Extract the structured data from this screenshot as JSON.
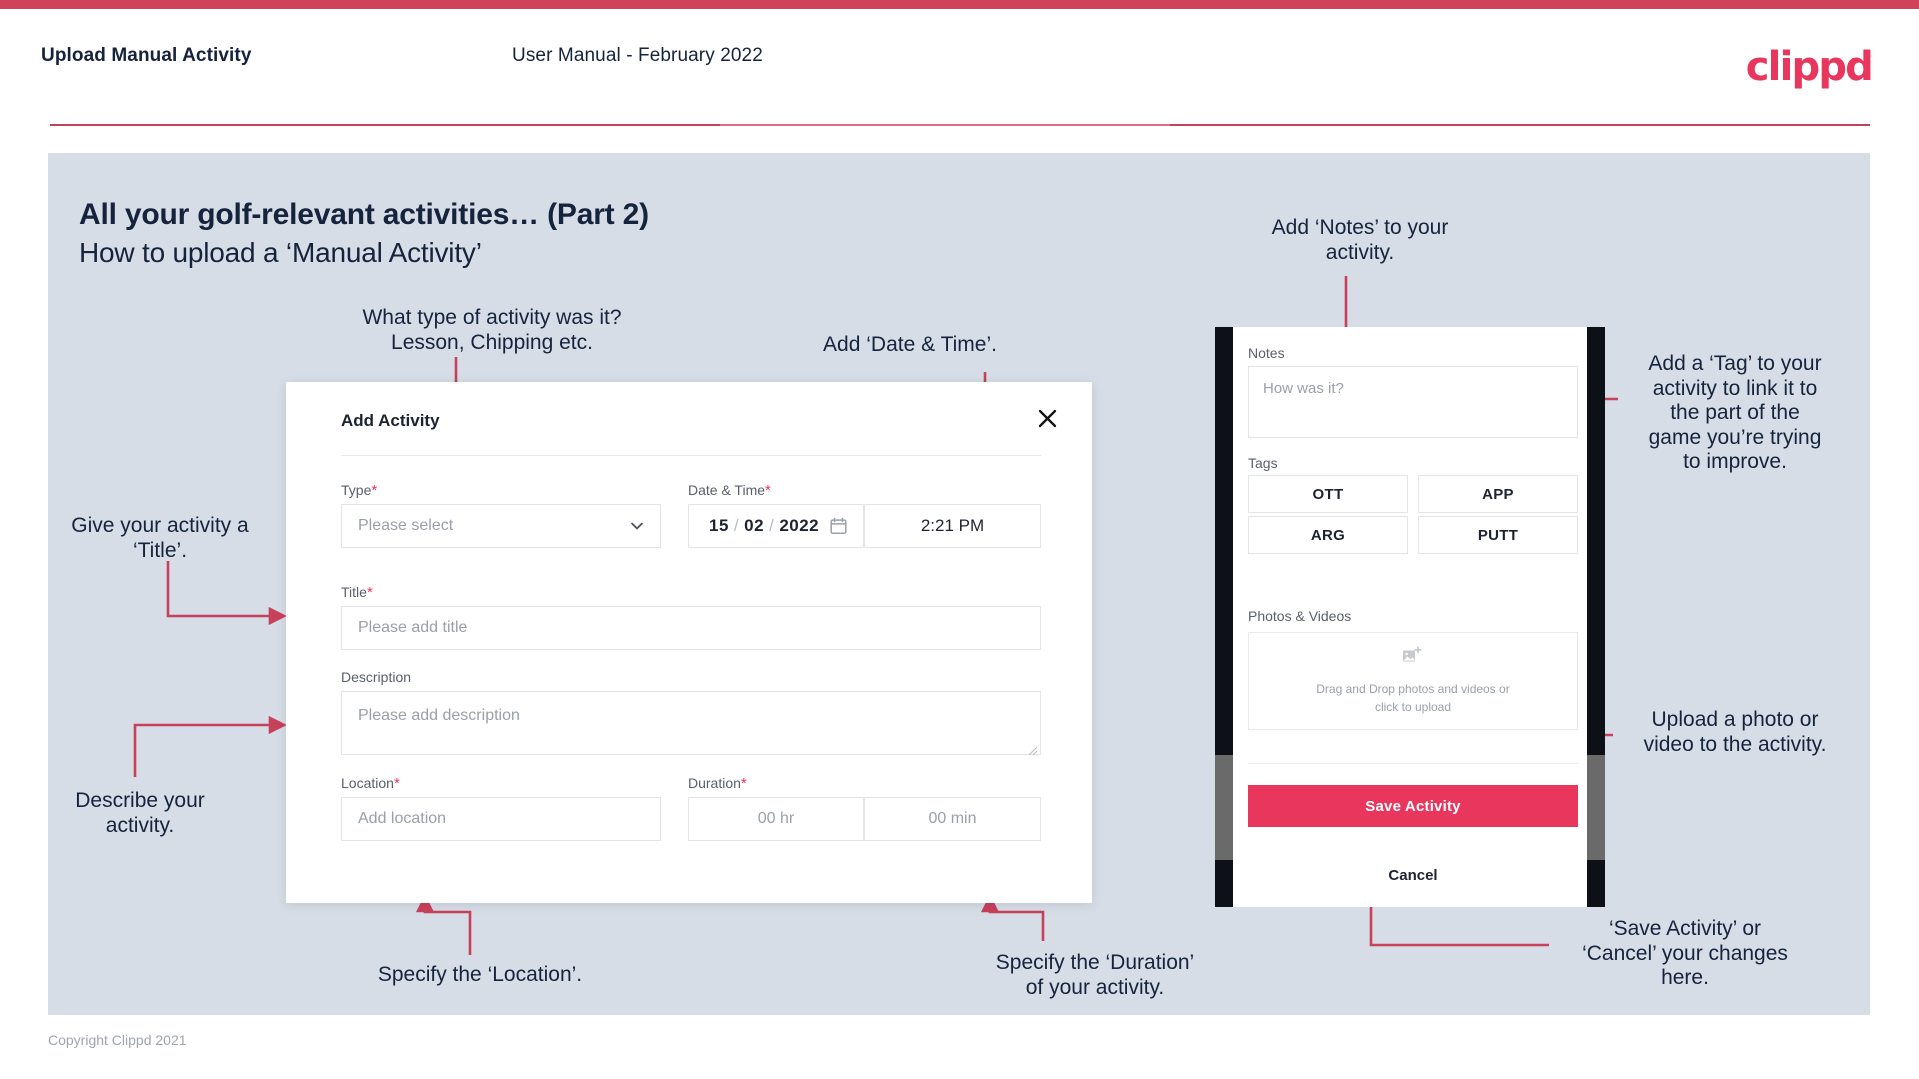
{
  "header": {
    "title": "Upload Manual Activity",
    "subtitle": "User Manual - February 2022",
    "logo": "clippd"
  },
  "slide": {
    "heading": "All your golf-relevant activities… (Part 2)",
    "subheading": "How to upload a ‘Manual Activity’"
  },
  "annotations": {
    "type": "What type of activity was it?\nLesson, Chipping etc.",
    "datetime": "Add ‘Date & Time’.",
    "notes": "Add ‘Notes’ to your\nactivity.",
    "tag": "Add a ‘Tag’ to your\nactivity to link it to\nthe part of the\ngame you’re trying\nto improve.",
    "title_field": "Give your activity a\n‘Title’.",
    "description_field": "Describe your\nactivity.",
    "location": "Specify the ‘Location’.",
    "duration": "Specify the ‘Duration’\nof your activity.",
    "upload": "Upload a photo or\nvideo to the activity.",
    "save_cancel": "‘Save Activity’ or\n‘Cancel’ your changes\nhere."
  },
  "dialog": {
    "title": "Add Activity",
    "close_icon": "close-icon",
    "fields": {
      "type": {
        "label": "Type",
        "required": "*",
        "placeholder": "Please select",
        "icon": "chevron-down-icon"
      },
      "datetime": {
        "label": "Date & Time",
        "required": "*",
        "day": "15",
        "month": "02",
        "year": "2022",
        "separator": "/",
        "icon": "calendar-icon",
        "time": "2:21 PM"
      },
      "title": {
        "label": "Title",
        "required": "*",
        "placeholder": "Please add title"
      },
      "description": {
        "label": "Description",
        "required": "",
        "placeholder": "Please add description"
      },
      "location": {
        "label": "Location",
        "required": "*",
        "placeholder": "Add location"
      },
      "duration": {
        "label": "Duration",
        "required": "*",
        "hours_placeholder": "00 hr",
        "minutes_placeholder": "00 min"
      }
    }
  },
  "phone": {
    "notes": {
      "label": "Notes",
      "placeholder": "How was it?"
    },
    "tags": {
      "label": "Tags",
      "items": [
        "OTT",
        "APP",
        "ARG",
        "PUTT"
      ]
    },
    "media": {
      "label": "Photos & Videos",
      "icon": "add-image-icon",
      "dropzone_line1": "Drag and Drop photos and videos or",
      "dropzone_line2": "click to upload"
    },
    "save_label": "Save Activity",
    "cancel_label": "Cancel"
  },
  "footer": {
    "copyright": "Copyright Clippd 2021"
  },
  "colors": {
    "brand_pink": "#e8365d",
    "accent_rule": "#c7415a",
    "slide_bg": "#d6dde6",
    "text_dark": "#16233c",
    "annotation_line": "#c7415a"
  }
}
